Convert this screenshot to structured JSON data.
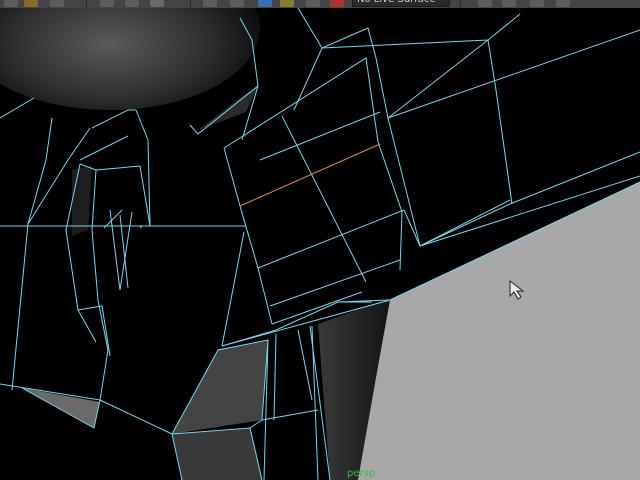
{
  "toolbar": {
    "icons": [
      "status-icon",
      "folder-icon",
      "save-icon",
      "select-object-icon",
      "lasso-select-icon",
      "paint-select-icon",
      "snap-grid-icon",
      "snap-curve-icon",
      "snap-point-icon",
      "snap-surface-icon",
      "make-live-icon",
      "magnet-icon",
      "render-icon",
      "ipr-render-icon",
      "render-settings-icon",
      "hypershade-icon"
    ],
    "field_value": "No Live Surface"
  },
  "viewport": {
    "camera_label": "persp",
    "colors": {
      "background": "#000000",
      "wireframe": "#78d6f0",
      "selected_edge": "#e3884a",
      "ground_plane": "#a8a8a8",
      "shaded_face": "#4a4a4a",
      "camera_label": "#3db84d"
    }
  }
}
